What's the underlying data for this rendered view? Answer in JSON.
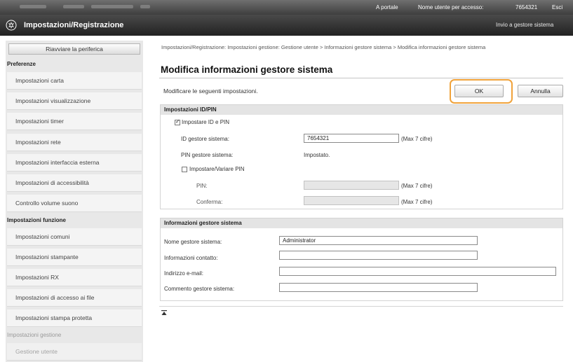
{
  "topbar": {
    "portal_link": "A portale",
    "user_label": "Nome utente per accesso:",
    "user_value": "7654321",
    "logout_link": "Esci"
  },
  "header": {
    "icon": "gear-icon",
    "title": "Impostazioni/Registrazione",
    "mail_admin_link": "Invio a gestore sistema"
  },
  "sidebar": {
    "restart_button": "Riavviare la periferica",
    "section_preferences": "Preferenze",
    "preferences": [
      "Impostazioni carta",
      "Impostazioni visualizzazione",
      "Impostazioni timer",
      "Impostazioni rete",
      "Impostazioni interfaccia esterna",
      "Impostazioni di accessibilità",
      "Controllo volume suono"
    ],
    "section_functions": "Impostazioni funzione",
    "functions": [
      "Impostazioni comuni",
      "Impostazioni stampante",
      "Impostazioni RX",
      "Impostazioni di accesso ai file",
      "Impostazioni stampa protetta"
    ],
    "section_management": "Impostazioni gestione",
    "management": [
      "Gestione utente"
    ]
  },
  "main": {
    "breadcrumb": "Impostazioni/Registrazione: Impostazioni gestione: Gestione utente > Informazioni gestore sistema > Modifica informazioni gestore sistema",
    "title": "Modifica informazioni gestore sistema",
    "instruction": "Modificare le seguenti impostazioni.",
    "ok_label": "OK",
    "cancel_label": "Annulla",
    "highlight_color": "#f0a23a"
  },
  "idpin": {
    "heading": "Impostazioni ID/PIN",
    "set_id_pin_label": "Impostare ID e PIN",
    "set_id_pin_checked": true,
    "admin_id_label": "ID gestore sistema:",
    "admin_id_value": "7654321",
    "admin_id_hint": "(Max 7 cifre)",
    "admin_pin_label": "PIN gestore sistema:",
    "admin_pin_status": "Impostato.",
    "change_pin_label": "Impostare/Variare PIN",
    "change_pin_checked": false,
    "pin_label": "PIN:",
    "pin_hint": "(Max 7 cifre)",
    "confirm_label": "Conferma:",
    "confirm_hint": "(Max 7 cifre)"
  },
  "info": {
    "heading": "Informazioni gestore sistema",
    "name_label": "Nome gestore sistema:",
    "name_value": "Administrator",
    "contact_label": "Informazioni contatto:",
    "contact_value": "",
    "email_label": "Indirizzo e-mail:",
    "email_value": "",
    "comment_label": "Commento gestore sistema:",
    "comment_value": ""
  }
}
